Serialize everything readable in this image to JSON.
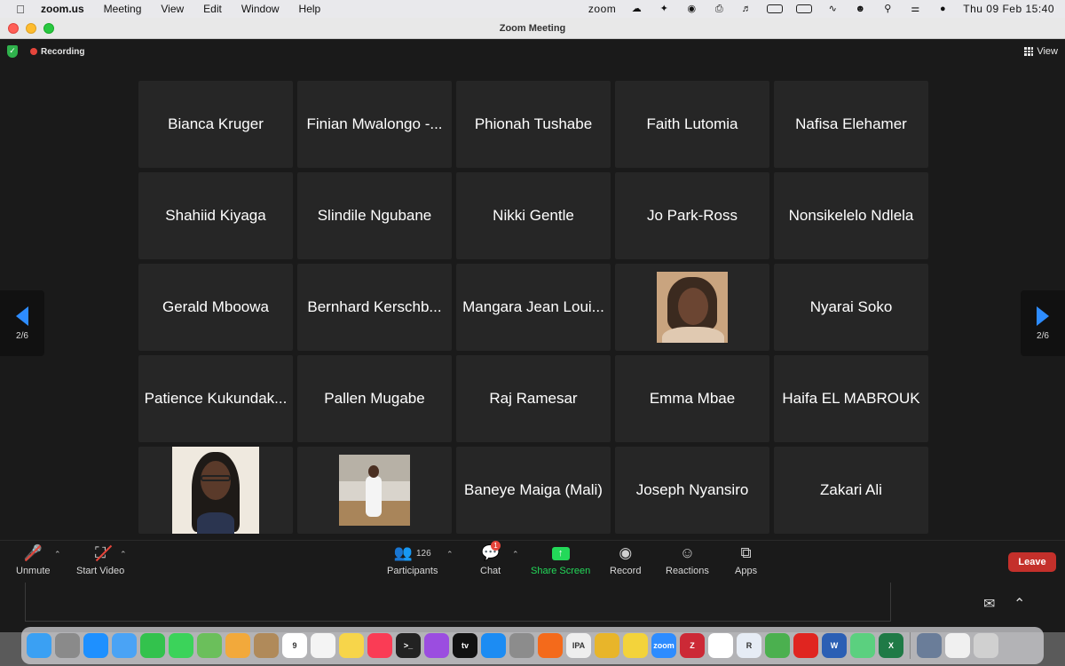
{
  "menubar": {
    "app_name": "zoom.us",
    "menus": [
      "Meeting",
      "View",
      "Edit",
      "Window",
      "Help"
    ],
    "status_app": "zoom",
    "datetime": "Thu 09 Feb  15:40"
  },
  "window": {
    "title": "Zoom Meeting"
  },
  "topbar": {
    "recording_label": "Recording",
    "view_label": "View"
  },
  "gallery": {
    "page_left": "2/6",
    "page_right": "2/6",
    "tiles": [
      {
        "name": "Bianca Kruger"
      },
      {
        "name": "Finian Mwalongo -..."
      },
      {
        "name": "Phionah Tushabe"
      },
      {
        "name": "Faith Lutomia"
      },
      {
        "name": "Nafisa Elehamer"
      },
      {
        "name": "Shahiid Kiyaga"
      },
      {
        "name": "Slindile Ngubane"
      },
      {
        "name": "Nikki Gentle"
      },
      {
        "name": "Jo Park-Ross"
      },
      {
        "name": "Nonsikelelo Ndlela"
      },
      {
        "name": "Gerald Mboowa"
      },
      {
        "name": "Bernhard Kerschb..."
      },
      {
        "name": "Mangara Jean Loui..."
      },
      {
        "video": "photo-1"
      },
      {
        "name": "Nyarai Soko"
      },
      {
        "name": "Patience Kukundak..."
      },
      {
        "name": "Pallen Mugabe"
      },
      {
        "name": "Raj Ramesar"
      },
      {
        "name": "Emma Mbae"
      },
      {
        "name": "Haifa EL MABROUK"
      },
      {
        "video": "photo-2"
      },
      {
        "video": "photo-3"
      },
      {
        "name": "Baneye Maiga (Mali)"
      },
      {
        "name": "Joseph Nyansiro"
      },
      {
        "name": "Zakari Ali"
      }
    ]
  },
  "toolbar": {
    "unmute_label": "Unmute",
    "start_video_label": "Start Video",
    "participants_label": "Participants",
    "participants_count": "126",
    "chat_label": "Chat",
    "chat_badge": "1",
    "share_label": "Share Screen",
    "record_label": "Record",
    "reactions_label": "Reactions",
    "apps_label": "Apps",
    "leave_label": "Leave"
  },
  "colors": {
    "accent_blue": "#2d8cff",
    "share_green": "#23d959",
    "leave_red": "#c4302b",
    "recording_red": "#e5453b",
    "tile_bg": "#262626"
  },
  "dock": {
    "apps": [
      {
        "icon": "finder-icon",
        "color": "#3aa0f3",
        "label": ""
      },
      {
        "icon": "launchpad-icon",
        "color": "#8a8a8a",
        "label": ""
      },
      {
        "icon": "safari-icon",
        "color": "#1e90ff",
        "label": ""
      },
      {
        "icon": "mail-icon",
        "color": "#4aa3f5",
        "label": ""
      },
      {
        "icon": "facetime-icon",
        "color": "#33c24d",
        "label": ""
      },
      {
        "icon": "messages-icon",
        "color": "#3bd35a",
        "label": ""
      },
      {
        "icon": "maps-icon",
        "color": "#6bbf5b",
        "label": ""
      },
      {
        "icon": "photos-icon",
        "color": "#f2a93b",
        "label": ""
      },
      {
        "icon": "contacts-icon",
        "color": "#b08a5a",
        "label": ""
      },
      {
        "icon": "calendar-icon",
        "color": "#ffffff",
        "label": "9"
      },
      {
        "icon": "reminders-icon",
        "color": "#f4f4f4",
        "label": ""
      },
      {
        "icon": "notes-icon",
        "color": "#f7d54a",
        "label": ""
      },
      {
        "icon": "music-icon",
        "color": "#fa3c55",
        "label": ""
      },
      {
        "icon": "terminal-icon",
        "color": "#222222",
        "label": ">_"
      },
      {
        "icon": "podcasts-icon",
        "color": "#9b4de0",
        "label": ""
      },
      {
        "icon": "tv-icon",
        "color": "#111111",
        "label": "tv"
      },
      {
        "icon": "appstore-icon",
        "color": "#1c8cf3",
        "label": ""
      },
      {
        "icon": "settings-icon",
        "color": "#8c8c8c",
        "label": ""
      },
      {
        "icon": "firefox-icon",
        "color": "#f46a1b",
        "label": ""
      },
      {
        "icon": "ipa-icon",
        "color": "#eeeeee",
        "label": "IPA"
      },
      {
        "icon": "chrome-icon",
        "color": "#e8b52a",
        "label": ""
      },
      {
        "icon": "activity-icon",
        "color": "#f3d33b",
        "label": ""
      },
      {
        "icon": "zoom-icon",
        "color": "#2d8cff",
        "label": "zoom"
      },
      {
        "icon": "zotero-icon",
        "color": "#cc2936",
        "label": "Z"
      },
      {
        "icon": "slack-icon",
        "color": "#ffffff",
        "label": ""
      },
      {
        "icon": "r-icon",
        "color": "#e6ecf5",
        "label": "R"
      },
      {
        "icon": "network-icon",
        "color": "#4bb04f",
        "label": ""
      },
      {
        "icon": "acrobat-icon",
        "color": "#e02520",
        "label": ""
      },
      {
        "icon": "word-icon",
        "color": "#2b5fb4",
        "label": "W"
      },
      {
        "icon": "atom-icon",
        "color": "#5bd07f",
        "label": ""
      },
      {
        "icon": "excel-icon",
        "color": "#1f7a46",
        "label": "X"
      },
      {
        "icon": "preview-icon",
        "color": "#6a7d99",
        "label": ""
      },
      {
        "icon": "document-icon",
        "color": "#f0f0f0",
        "label": ""
      },
      {
        "icon": "trash-icon",
        "color": "#d0d0d0",
        "label": ""
      }
    ]
  }
}
